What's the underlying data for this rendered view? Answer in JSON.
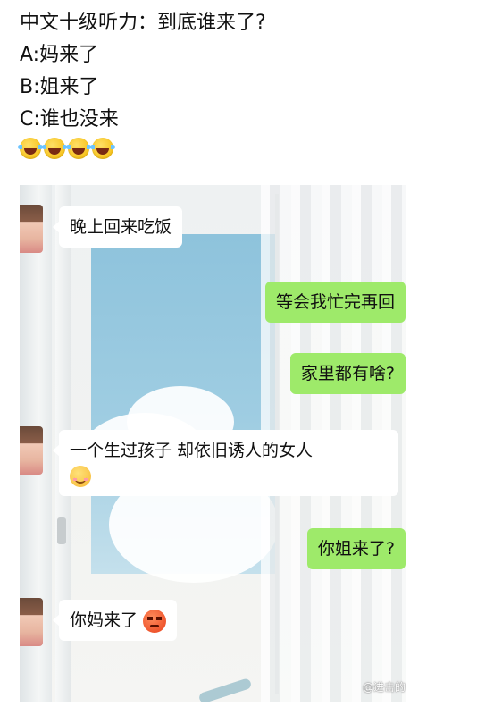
{
  "post": {
    "question": "中文十级听力：到底谁来了?",
    "option_a": "A:妈来了",
    "option_b": "B:姐来了",
    "option_c": "C:谁也没来",
    "emoji_icons": [
      "laughing-tears-icon",
      "laughing-tears-icon",
      "laughing-tears-icon",
      "laughing-tears-icon"
    ]
  },
  "chat": {
    "messages": [
      {
        "side": "in",
        "text": "晚上回来吃饭"
      },
      {
        "side": "out",
        "text": "等会我忙完再回"
      },
      {
        "side": "out",
        "text": "家里都有啥?"
      },
      {
        "side": "in",
        "text": "一个生过孩子  却依旧诱人的女人",
        "emoji": "smile-blush-icon"
      },
      {
        "side": "out",
        "text": "你姐来了?"
      },
      {
        "side": "in",
        "text": "你妈来了",
        "emoji": "angry-face-icon"
      }
    ],
    "watermark": "@进击的"
  },
  "colors": {
    "outgoing_bubble": "#9eea6a",
    "incoming_bubble": "#ffffff",
    "sky": "#9fcde2"
  }
}
